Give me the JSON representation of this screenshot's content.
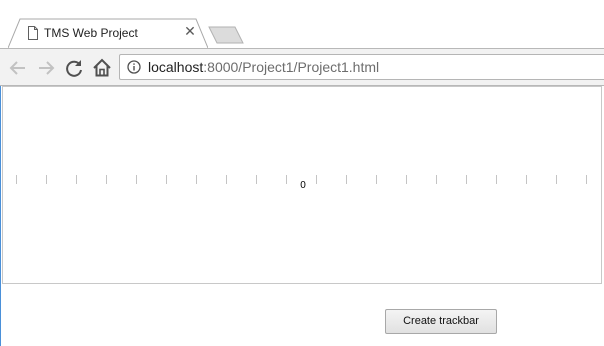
{
  "browser": {
    "tab": {
      "title": "TMS Web Project",
      "close_glyph": "✕",
      "icon": "document-icon"
    },
    "new_tab_icon": "new-tab-icon",
    "toolbar": {
      "back_icon": "back-arrow-icon",
      "forward_icon": "forward-arrow-icon",
      "reload_icon": "reload-icon",
      "home_icon": "home-icon"
    },
    "address_bar": {
      "icon": "info-icon",
      "host": "localhost",
      "rest": ":8000/Project1/Project1.html"
    }
  },
  "page": {
    "trackbar": {
      "value": "0",
      "tick_count": 20,
      "tick_color": "#c4c4c4"
    },
    "create_button_label": "Create trackbar"
  }
}
